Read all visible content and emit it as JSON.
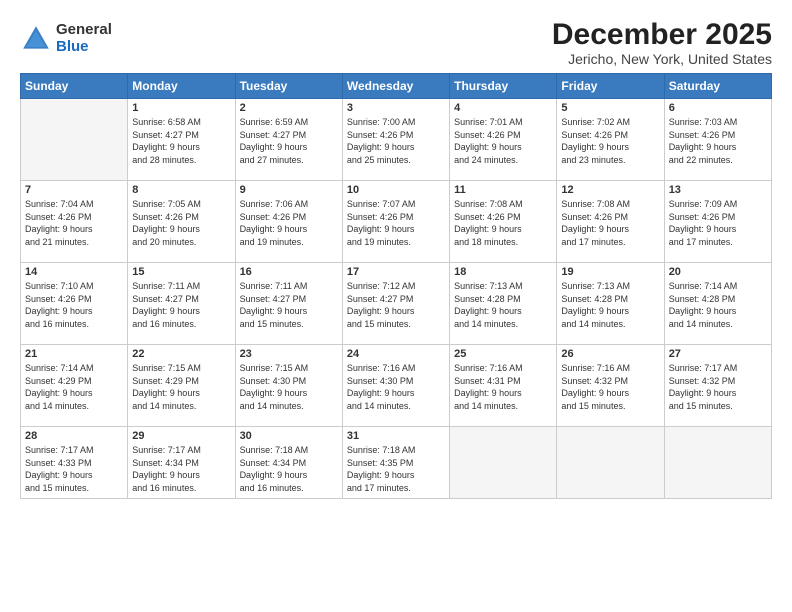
{
  "header": {
    "logo_general": "General",
    "logo_blue": "Blue",
    "main_title": "December 2025",
    "subtitle": "Jericho, New York, United States"
  },
  "calendar": {
    "days_of_week": [
      "Sunday",
      "Monday",
      "Tuesday",
      "Wednesday",
      "Thursday",
      "Friday",
      "Saturday"
    ],
    "weeks": [
      [
        {
          "day": "",
          "info": ""
        },
        {
          "day": "1",
          "info": "Sunrise: 6:58 AM\nSunset: 4:27 PM\nDaylight: 9 hours\nand 28 minutes."
        },
        {
          "day": "2",
          "info": "Sunrise: 6:59 AM\nSunset: 4:27 PM\nDaylight: 9 hours\nand 27 minutes."
        },
        {
          "day": "3",
          "info": "Sunrise: 7:00 AM\nSunset: 4:26 PM\nDaylight: 9 hours\nand 25 minutes."
        },
        {
          "day": "4",
          "info": "Sunrise: 7:01 AM\nSunset: 4:26 PM\nDaylight: 9 hours\nand 24 minutes."
        },
        {
          "day": "5",
          "info": "Sunrise: 7:02 AM\nSunset: 4:26 PM\nDaylight: 9 hours\nand 23 minutes."
        },
        {
          "day": "6",
          "info": "Sunrise: 7:03 AM\nSunset: 4:26 PM\nDaylight: 9 hours\nand 22 minutes."
        }
      ],
      [
        {
          "day": "7",
          "info": "Sunrise: 7:04 AM\nSunset: 4:26 PM\nDaylight: 9 hours\nand 21 minutes."
        },
        {
          "day": "8",
          "info": "Sunrise: 7:05 AM\nSunset: 4:26 PM\nDaylight: 9 hours\nand 20 minutes."
        },
        {
          "day": "9",
          "info": "Sunrise: 7:06 AM\nSunset: 4:26 PM\nDaylight: 9 hours\nand 19 minutes."
        },
        {
          "day": "10",
          "info": "Sunrise: 7:07 AM\nSunset: 4:26 PM\nDaylight: 9 hours\nand 19 minutes."
        },
        {
          "day": "11",
          "info": "Sunrise: 7:08 AM\nSunset: 4:26 PM\nDaylight: 9 hours\nand 18 minutes."
        },
        {
          "day": "12",
          "info": "Sunrise: 7:08 AM\nSunset: 4:26 PM\nDaylight: 9 hours\nand 17 minutes."
        },
        {
          "day": "13",
          "info": "Sunrise: 7:09 AM\nSunset: 4:26 PM\nDaylight: 9 hours\nand 17 minutes."
        }
      ],
      [
        {
          "day": "14",
          "info": "Sunrise: 7:10 AM\nSunset: 4:26 PM\nDaylight: 9 hours\nand 16 minutes."
        },
        {
          "day": "15",
          "info": "Sunrise: 7:11 AM\nSunset: 4:27 PM\nDaylight: 9 hours\nand 16 minutes."
        },
        {
          "day": "16",
          "info": "Sunrise: 7:11 AM\nSunset: 4:27 PM\nDaylight: 9 hours\nand 15 minutes."
        },
        {
          "day": "17",
          "info": "Sunrise: 7:12 AM\nSunset: 4:27 PM\nDaylight: 9 hours\nand 15 minutes."
        },
        {
          "day": "18",
          "info": "Sunrise: 7:13 AM\nSunset: 4:28 PM\nDaylight: 9 hours\nand 14 minutes."
        },
        {
          "day": "19",
          "info": "Sunrise: 7:13 AM\nSunset: 4:28 PM\nDaylight: 9 hours\nand 14 minutes."
        },
        {
          "day": "20",
          "info": "Sunrise: 7:14 AM\nSunset: 4:28 PM\nDaylight: 9 hours\nand 14 minutes."
        }
      ],
      [
        {
          "day": "21",
          "info": "Sunrise: 7:14 AM\nSunset: 4:29 PM\nDaylight: 9 hours\nand 14 minutes."
        },
        {
          "day": "22",
          "info": "Sunrise: 7:15 AM\nSunset: 4:29 PM\nDaylight: 9 hours\nand 14 minutes."
        },
        {
          "day": "23",
          "info": "Sunrise: 7:15 AM\nSunset: 4:30 PM\nDaylight: 9 hours\nand 14 minutes."
        },
        {
          "day": "24",
          "info": "Sunrise: 7:16 AM\nSunset: 4:30 PM\nDaylight: 9 hours\nand 14 minutes."
        },
        {
          "day": "25",
          "info": "Sunrise: 7:16 AM\nSunset: 4:31 PM\nDaylight: 9 hours\nand 14 minutes."
        },
        {
          "day": "26",
          "info": "Sunrise: 7:16 AM\nSunset: 4:32 PM\nDaylight: 9 hours\nand 15 minutes."
        },
        {
          "day": "27",
          "info": "Sunrise: 7:17 AM\nSunset: 4:32 PM\nDaylight: 9 hours\nand 15 minutes."
        }
      ],
      [
        {
          "day": "28",
          "info": "Sunrise: 7:17 AM\nSunset: 4:33 PM\nDaylight: 9 hours\nand 15 minutes."
        },
        {
          "day": "29",
          "info": "Sunrise: 7:17 AM\nSunset: 4:34 PM\nDaylight: 9 hours\nand 16 minutes."
        },
        {
          "day": "30",
          "info": "Sunrise: 7:18 AM\nSunset: 4:34 PM\nDaylight: 9 hours\nand 16 minutes."
        },
        {
          "day": "31",
          "info": "Sunrise: 7:18 AM\nSunset: 4:35 PM\nDaylight: 9 hours\nand 17 minutes."
        },
        {
          "day": "",
          "info": ""
        },
        {
          "day": "",
          "info": ""
        },
        {
          "day": "",
          "info": ""
        }
      ]
    ]
  }
}
